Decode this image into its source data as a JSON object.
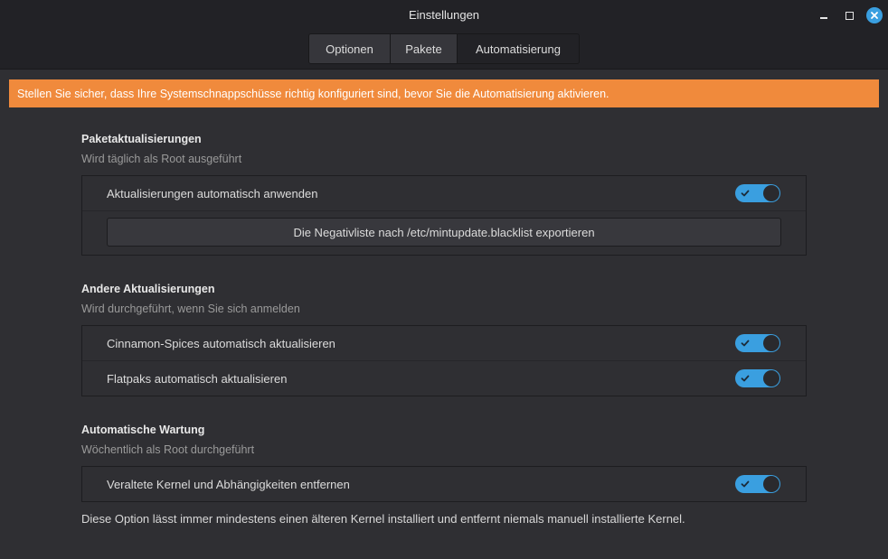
{
  "window": {
    "title": "Einstellungen"
  },
  "tabs": [
    {
      "label": "Optionen",
      "active": false
    },
    {
      "label": "Pakete",
      "active": false
    },
    {
      "label": "Automatisierung",
      "active": true
    }
  ],
  "warning": {
    "text": "Stellen Sie sicher, dass Ihre Systemschnappschüsse richtig konfiguriert sind, bevor Sie die Automatisierung aktivieren.",
    "color": "#f08a3c"
  },
  "sections": {
    "packages": {
      "title": "Paketaktualisierungen",
      "subtitle": "Wird täglich als Root ausgeführt",
      "auto_apply": {
        "label": "Aktualisierungen automatisch anwenden",
        "enabled": true
      },
      "export_button": "Die Negativliste nach /etc/mintupdate.blacklist exportieren"
    },
    "other": {
      "title": "Andere Aktualisierungen",
      "subtitle": "Wird durchgeführt, wenn Sie sich anmelden",
      "cinnamon": {
        "label": "Cinnamon-Spices automatisch aktualisieren",
        "enabled": true
      },
      "flatpak": {
        "label": "Flatpaks automatisch aktualisieren",
        "enabled": true
      }
    },
    "maintenance": {
      "title": "Automatische Wartung",
      "subtitle": "Wöchentlich als Root durchgeführt",
      "kernels": {
        "label": "Veraltete Kernel und Abhängigkeiten entfernen",
        "enabled": true
      },
      "footnote": "Diese Option lässt immer mindestens einen älteren Kernel installiert und entfernt niemals manuell installierte Kernel."
    }
  },
  "colors": {
    "accent": "#3a9fe0",
    "background": "#2f2f33",
    "headerbar": "#222226"
  },
  "icons": {
    "minimize": "minimize-icon",
    "maximize": "maximize-icon",
    "close": "close-icon",
    "toggle_check": "check-icon"
  }
}
